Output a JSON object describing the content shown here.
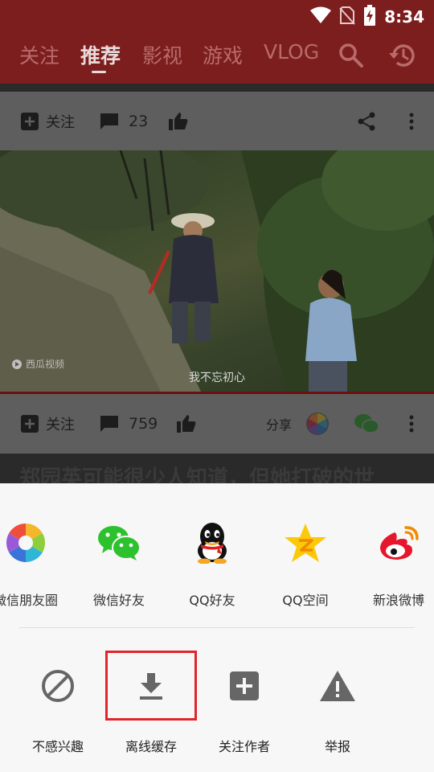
{
  "status_bar": {
    "time": "8:34"
  },
  "top_nav": {
    "tabs": [
      {
        "label": "关注",
        "active": false
      },
      {
        "label": "推荐",
        "active": true
      },
      {
        "label": "影视",
        "active": false
      },
      {
        "label": "游戏",
        "active": false
      },
      {
        "label": "VLOG",
        "active": false
      }
    ],
    "icons": [
      "search-icon",
      "history-icon"
    ]
  },
  "feed": {
    "card1_bar": {
      "follow_label": "关注",
      "comment_count": "23"
    },
    "video": {
      "subtitle": "我不忘初心",
      "watermark": "西瓜视频"
    },
    "card2_bar": {
      "follow_label": "关注",
      "comment_count": "759",
      "share_label": "分享"
    },
    "next_title": "郑园英可能很少人知道，但她打破的世"
  },
  "share_sheet": {
    "share_targets": [
      {
        "label": "微信朋友圈",
        "icon": "moments-icon"
      },
      {
        "label": "微信好友",
        "icon": "wechat-icon"
      },
      {
        "label": "QQ好友",
        "icon": "qq-icon"
      },
      {
        "label": "QQ空间",
        "icon": "qzone-icon"
      },
      {
        "label": "新浪微博",
        "icon": "weibo-icon"
      }
    ],
    "actions": [
      {
        "label": "不感兴趣",
        "icon": "not-interested-icon"
      },
      {
        "label": "离线缓存",
        "icon": "download-icon",
        "highlighted": true
      },
      {
        "label": "关注作者",
        "icon": "follow-author-icon"
      },
      {
        "label": "举报",
        "icon": "report-icon"
      }
    ]
  },
  "colors": {
    "top_bar": "#7c1e1e",
    "sheet_bg": "#f7f7f7",
    "highlight_border": "#e0242a",
    "action_icon": "#666666"
  }
}
